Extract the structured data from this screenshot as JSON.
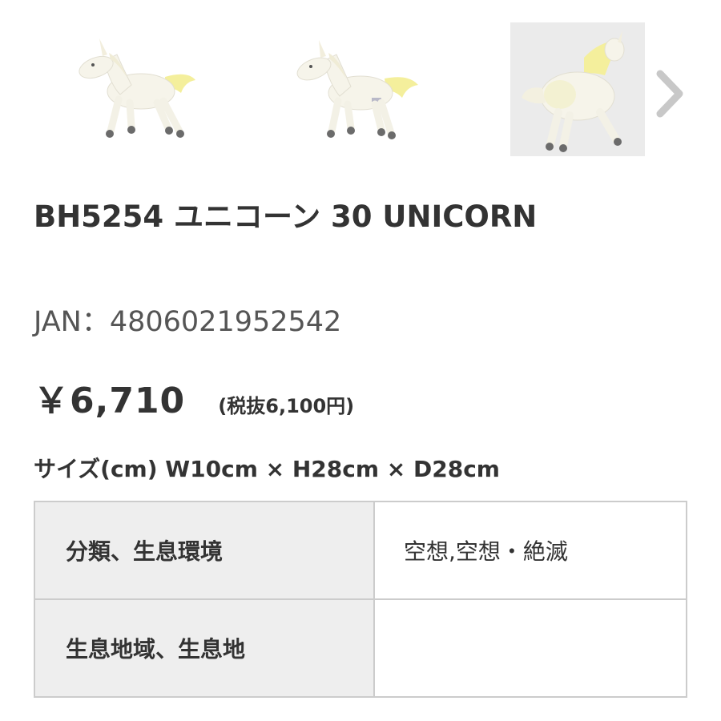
{
  "gallery": {
    "thumbnails": [
      {
        "subject": "unicorn plush, side view facing left",
        "icon": "unicorn-plush-image"
      },
      {
        "subject": "unicorn plush, side view facing left",
        "icon": "unicorn-plush-image"
      },
      {
        "subject": "unicorn plush, rear view on grey background",
        "icon": "unicorn-plush-image"
      }
    ],
    "next_icon": "chevron-right-icon",
    "colors": {
      "thumb_selected_bg": "#ebebeb",
      "arrow": "#c8c8c8",
      "plush_body": "#f6f4ea",
      "plush_mane": "#f4ef9c",
      "plush_hoof": "#6b6b6b"
    }
  },
  "product": {
    "title": "BH5254 ユニコーン 30 UNICORN",
    "jan": "JAN：4806021952542",
    "price": "￥6,710",
    "price_tax_note": "(税抜6,100円)",
    "size": "サイズ(cm) W10cm × H28cm × D28cm"
  },
  "spec_table": {
    "rows": [
      {
        "label": "分類、生息環境",
        "value": "空想,空想・絶滅"
      },
      {
        "label": "生息地域、生息地",
        "value": ""
      }
    ],
    "colors": {
      "border": "#cccccc",
      "label_bg": "#eeeeee"
    }
  }
}
